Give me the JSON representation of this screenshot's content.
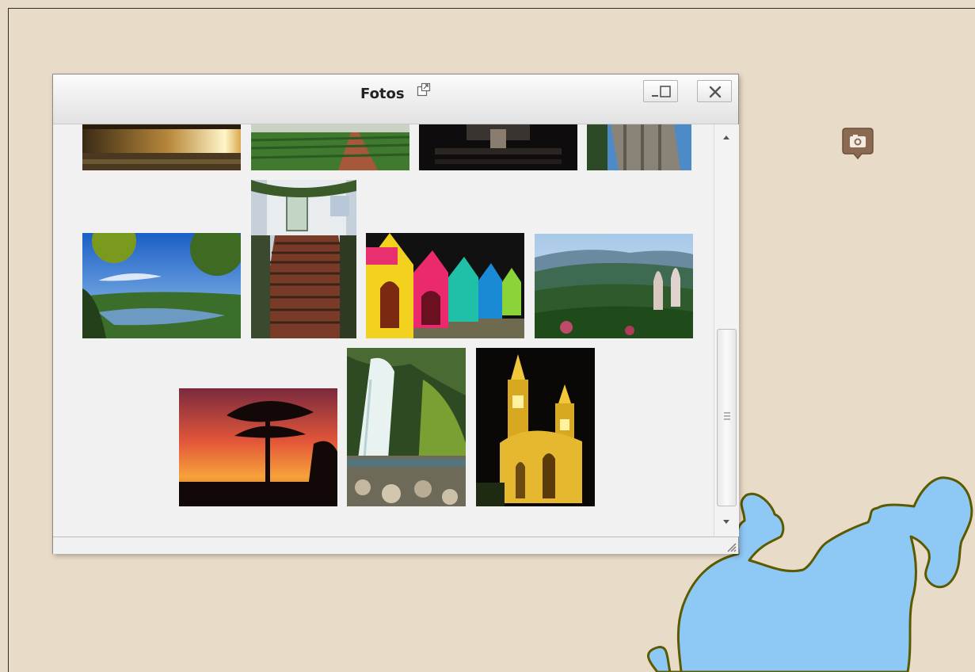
{
  "window": {
    "title": "Fotos",
    "icons": {
      "popout": "external-window-icon",
      "maximize": "minimize-maximize-icon",
      "close": "close-icon",
      "marker": "camera-marker-icon",
      "resize": "resize-grip-icon"
    }
  },
  "photos": [
    {
      "name": "sunset-lake",
      "row": 1
    },
    {
      "name": "green-field-rows",
      "row": 1
    },
    {
      "name": "dark-interior",
      "row": 1
    },
    {
      "name": "tree-trunk",
      "row": 1
    },
    {
      "name": "lake-blue-sky",
      "row": 2
    },
    {
      "name": "stone-stairs-house",
      "row": 2
    },
    {
      "name": "colorful-doghouses",
      "row": 2
    },
    {
      "name": "mountain-valley",
      "row": 2
    },
    {
      "name": "araucaria-sunset",
      "row": 3
    },
    {
      "name": "waterfall",
      "row": 3
    },
    {
      "name": "lit-cathedral",
      "row": 3
    }
  ],
  "colors": {
    "map_background": "#e8dcc8",
    "lake_fill": "#8ec9f5",
    "lake_outline": "#5c5a00",
    "marker_fill": "#8c6a52"
  }
}
